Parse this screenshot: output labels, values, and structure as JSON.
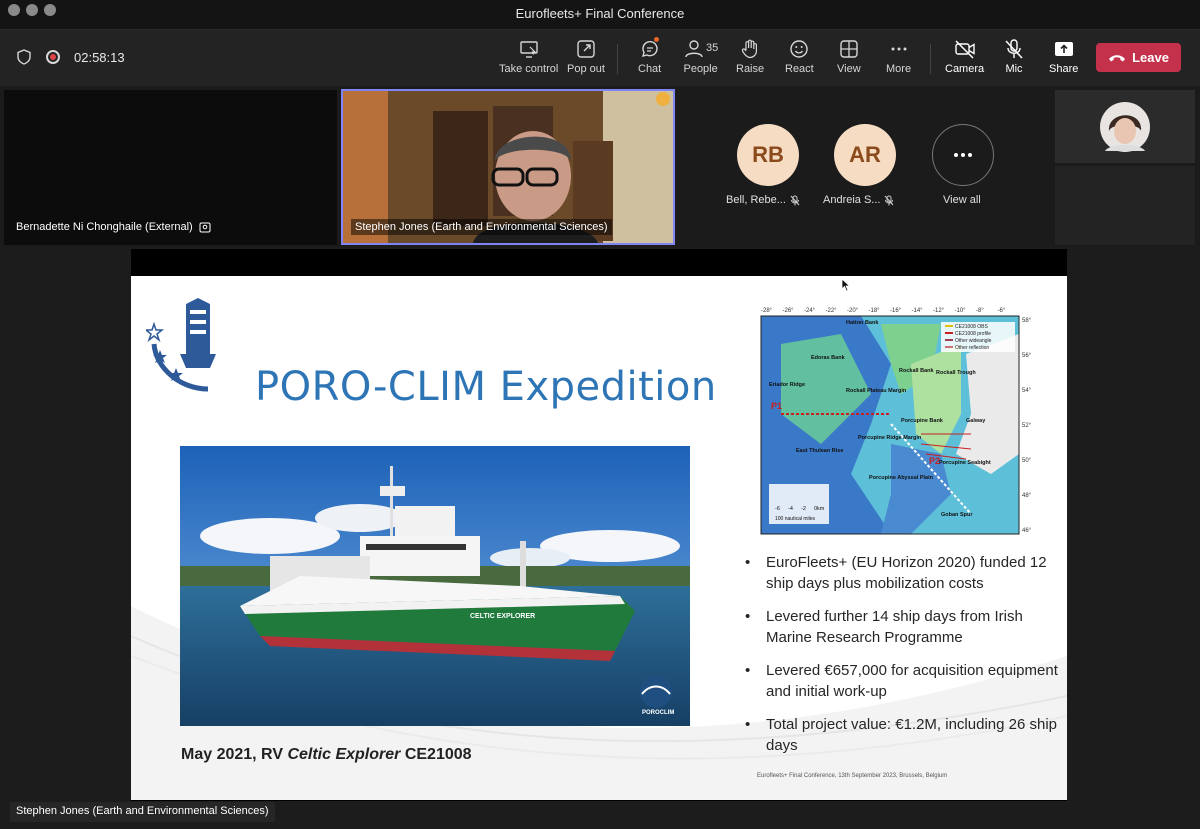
{
  "window": {
    "title": "Eurofleets+ Final Conference"
  },
  "toolbar": {
    "timer": "02:58:13",
    "take_control": "Take control",
    "pop_out": "Pop out",
    "chat": "Chat",
    "people": "People",
    "people_count": "35",
    "raise": "Raise",
    "react": "React",
    "view": "View",
    "more": "More",
    "camera": "Camera",
    "mic": "Mic",
    "share": "Share",
    "leave": "Leave"
  },
  "participants": {
    "tile1_name": "Bernadette Ni Chonghaile (External)",
    "tile2_name": "Stephen Jones (Earth and Environmental Sciences)",
    "avatar1_initials": "RB",
    "avatar1_name": "Bell, Rebe...",
    "avatar2_initials": "AR",
    "avatar2_name": "Andreia S...",
    "view_all": "View all"
  },
  "slide": {
    "title": "PORO-CLIM Expedition",
    "caption_prefix": "May 2021, RV ",
    "caption_italic": "Celtic Explorer",
    "caption_suffix": " CE21008",
    "bullets": [
      "EuroFleets+ (EU Horizon 2020) funded 12 ship days plus mobilization costs",
      "Levered further 14 ship days from Irish Marine Research Programme",
      "Levered €657,000 for acquisition equipment and initial work-up",
      "Total project value: €1.2M, including 26 ship days"
    ],
    "footer_note": "Eurofleets+ Final Conference, 13th September 2023, Brussels, Belgium",
    "ship_name": "CELTIC EXPLORER",
    "logo_text": "POROCLIM",
    "map": {
      "lon_ticks": [
        "-28°",
        "-26°",
        "-24°",
        "-22°",
        "-20°",
        "-18°",
        "-16°",
        "-14°",
        "-12°",
        "-10°",
        "-8°",
        "-6°"
      ],
      "lat_ticks": [
        "58°",
        "56°",
        "54°",
        "52°",
        "50°",
        "48°",
        "46°"
      ],
      "legend": [
        "CE21008 OBS",
        "CE21008 profile",
        "Other wideangle",
        "Other reflection"
      ],
      "labels": [
        "Hatton Bank",
        "Edoras Bank",
        "Rockall Bank",
        "Rockall Trough",
        "Eriador Ridge",
        "Rockall Plateau Margin",
        "Porcupine Bank",
        "Galway",
        "East Thulean Rise",
        "Porcupine Ridge Margin",
        "Porcupine Seabight",
        "Porcupine Abyssal Plain",
        "Goban Spur",
        "P1",
        "P2"
      ],
      "depth_ticks": [
        "-6",
        "-4",
        "-2",
        "0km"
      ],
      "scale_label": "100 nautical miles"
    }
  },
  "presenter_label": "Stephen Jones (Earth and Environmental Sciences)"
}
